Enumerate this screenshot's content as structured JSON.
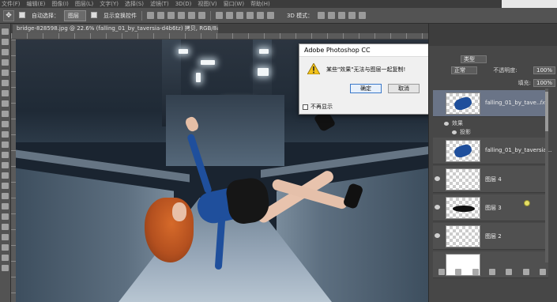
{
  "menubar": {
    "items": [
      "文件(F)",
      "编辑(E)",
      "图像(I)",
      "图层(L)",
      "文字(Y)",
      "选择(S)",
      "滤镜(T)",
      "3D(D)",
      "视图(V)",
      "窗口(W)",
      "帮助(H)"
    ]
  },
  "options": {
    "auto_select_label": "自动选择：",
    "auto_select_value": "图层",
    "show_transform_label": "显示变换控件",
    "mode3d_label": "3D 模式："
  },
  "document": {
    "tab_title": "bridge-828598.jpg @ 22.6% (falling_01_by_taversia-d4b6tz) 拷贝, RGB/8#) *"
  },
  "dialog": {
    "title": "Adobe Photoshop CC",
    "message": "某些\"效果\"无法与图层一起复制!",
    "ok_label": "确定",
    "cancel_label": "取消",
    "dont_show_label": "不再显示"
  },
  "layers_panel": {
    "kind_value": "类型",
    "blend_mode": "正常",
    "opacity_label": "不透明度:",
    "opacity_value": "100%",
    "fill_label": "填充:",
    "fill_value": "100%",
    "layers": [
      {
        "name": "falling_01_by_tave...",
        "fx": "fx",
        "selected": true
      },
      {
        "name": "falling_01_by_taversia..."
      },
      {
        "name": "图层 4"
      },
      {
        "name": "图层 3"
      },
      {
        "name": "图层 2"
      }
    ],
    "effects_label": "效果",
    "shadow_label": "投影"
  },
  "colors": {
    "selected_layer": "#6a7487",
    "panel_bg": "#474747",
    "dialog_bg": "#f0f0f0"
  },
  "icons": [
    "move-tool-icon",
    "warning-icon",
    "eye-icon",
    "fx-icon",
    "cursor-icon"
  ]
}
